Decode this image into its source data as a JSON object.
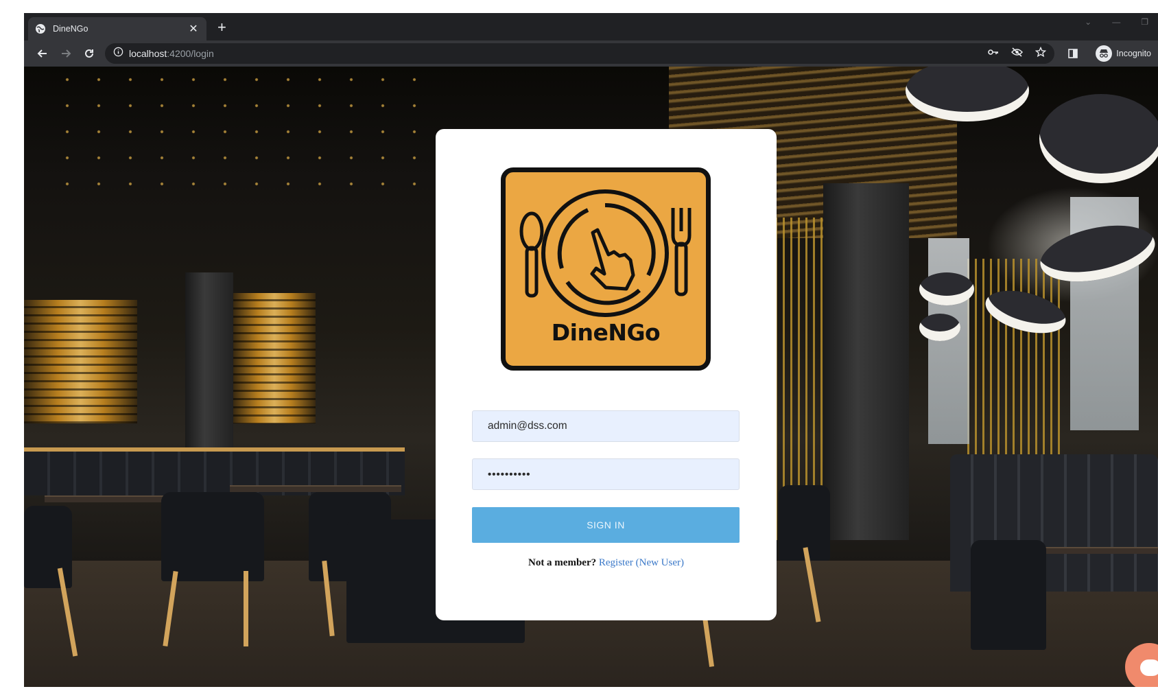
{
  "browser": {
    "tab": {
      "title": "DineNGo",
      "favicon": "globe-icon"
    },
    "toolbar": {
      "url_host": "localhost",
      "url_rest": ":4200/login",
      "profile_label": "Incognito"
    }
  },
  "login": {
    "brand": "DineNGo",
    "email_value": "admin@dss.com",
    "password_mask": "••••••••••",
    "signin_label": "SIGN IN",
    "member_prompt": "Not a member?",
    "register_link": "Register (New User)"
  },
  "colors": {
    "logo_bg": "#eba743",
    "signin_bg": "#5aade0",
    "input_bg": "#e8f0fe",
    "link": "#3a78c8"
  }
}
